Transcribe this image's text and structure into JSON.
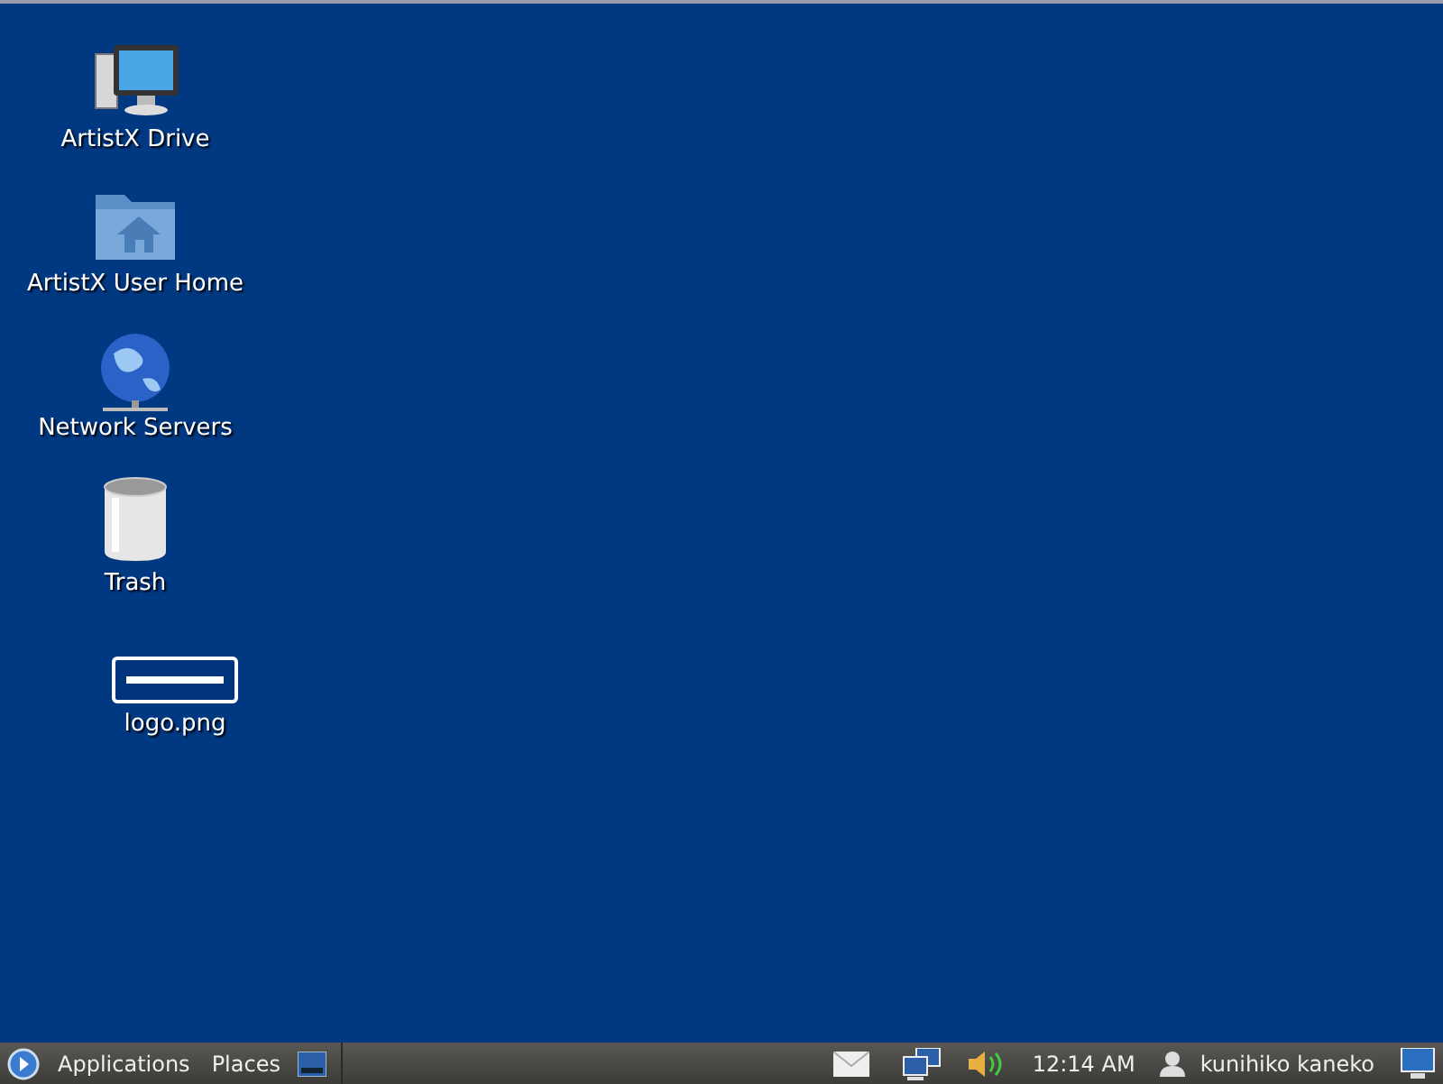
{
  "desktop": {
    "icons": [
      {
        "label": "ArtistX Drive",
        "kind": "computer"
      },
      {
        "label": "ArtistX User Home",
        "kind": "home"
      },
      {
        "label": "Network Servers",
        "kind": "network"
      },
      {
        "label": "Trash",
        "kind": "trash"
      },
      {
        "label": "logo.png",
        "kind": "image"
      }
    ]
  },
  "panel": {
    "menus": [
      "Applications",
      "Places"
    ],
    "clock": "12:14 AM",
    "user": "kunihiko kaneko"
  }
}
